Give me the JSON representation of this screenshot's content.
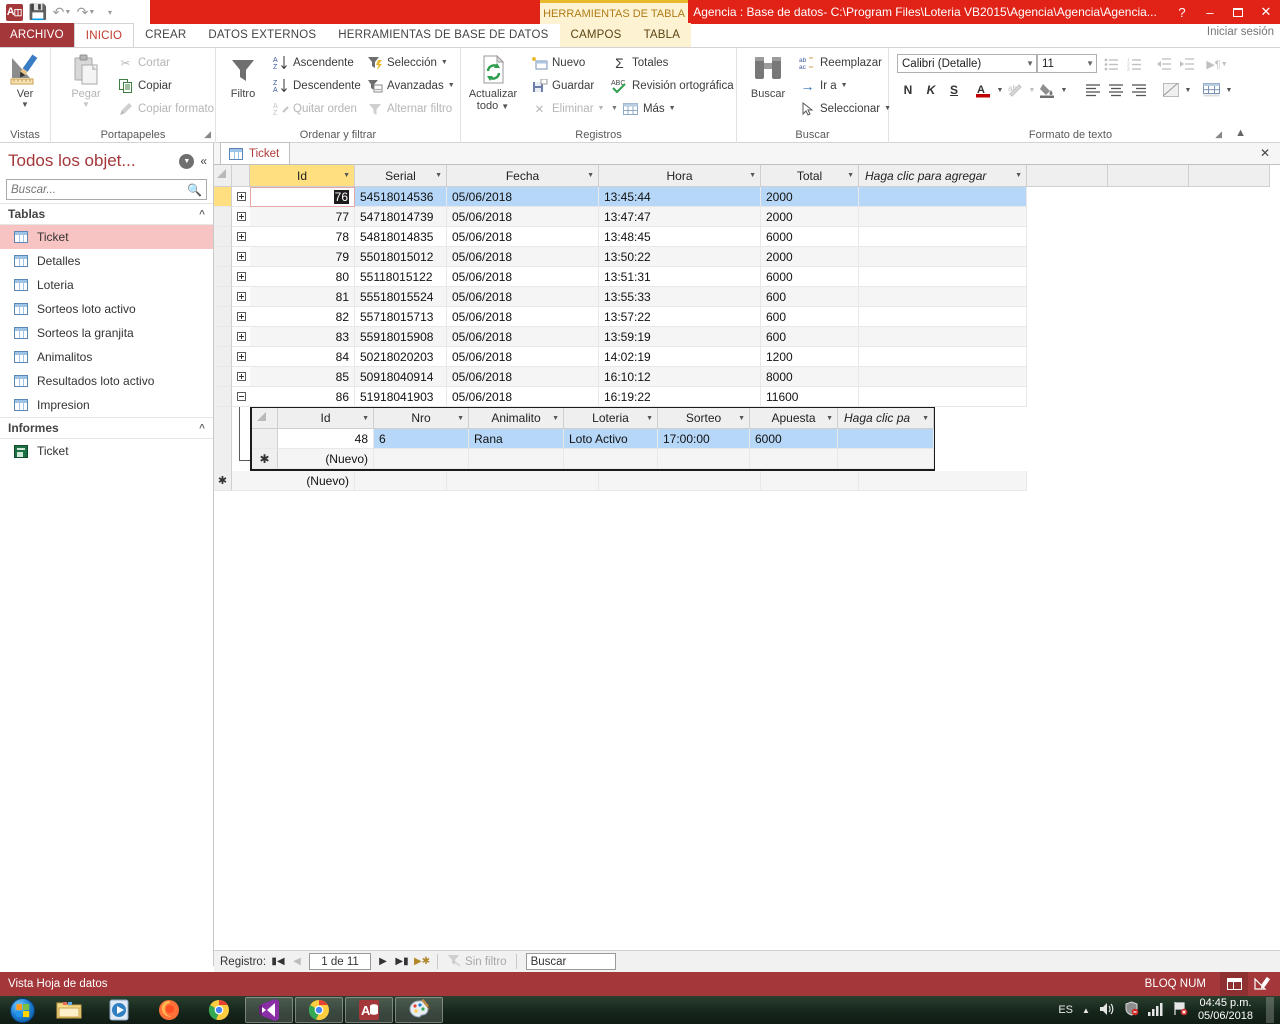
{
  "titlebar": {
    "app_icon": "access-logo-icon",
    "quick_access": [
      {
        "name": "save-icon",
        "glyph": "💾"
      },
      {
        "name": "undo-icon",
        "glyph": "↶"
      },
      {
        "name": "redo-icon",
        "glyph": "↷"
      },
      {
        "name": "customize-qat-icon",
        "glyph": "☰"
      }
    ],
    "contextual_tools_label": "HERRAMIENTAS DE TABLA",
    "document_title": "Agencia : Base de datos- C:\\Program Files\\Loteria VB2015\\Agencia\\Agencia\\Agencia...",
    "help": "?",
    "minimize": "–",
    "restore": "❐",
    "close": "✕",
    "accent_red": "#e02217",
    "accent_dark_red": "#a4373a",
    "contextual_yellow": "#e8b92b"
  },
  "ribbon_tabs": {
    "file": "ARCHIVO",
    "tabs": [
      "INICIO",
      "CREAR",
      "DATOS EXTERNOS",
      "HERRAMIENTAS DE BASE DE DATOS"
    ],
    "contextual_tabs": [
      "CAMPOS",
      "TABLA"
    ],
    "active": "INICIO",
    "sign_in": "Iniciar sesión"
  },
  "ribbon": {
    "groups": [
      {
        "name": "vistas",
        "title": "Vistas"
      },
      {
        "name": "portapapeles",
        "title": "Portapapeles"
      },
      {
        "name": "ordenar-y-filtrar",
        "title": "Ordenar y filtrar"
      },
      {
        "name": "registros",
        "title": "Registros"
      },
      {
        "name": "buscar",
        "title": "Buscar"
      },
      {
        "name": "formato-de-texto",
        "title": "Formato de texto"
      }
    ],
    "vistas": {
      "ver": "Ver"
    },
    "portapapeles": {
      "pegar": "Pegar",
      "cortar": "Cortar",
      "copiar": "Copiar",
      "copiar_formato": "Copiar formato"
    },
    "ordenar": {
      "filtro": "Filtro",
      "ascendente": "Ascendente",
      "descendente": "Descendente",
      "quitar_orden": "Quitar orden",
      "seleccion": "Selección",
      "avanzadas": "Avanzadas",
      "alternar_filtro": "Alternar filtro"
    },
    "registros": {
      "actualizar_todo": "Actualizar todo",
      "nuevo": "Nuevo",
      "guardar": "Guardar",
      "eliminar": "Eliminar",
      "totales": "Totales",
      "revision": "Revisión ortográfica",
      "mas": "Más"
    },
    "buscar": {
      "buscar": "Buscar",
      "reemplazar": "Reemplazar",
      "ir_a": "Ir a",
      "seleccionar": "Seleccionar"
    },
    "formato": {
      "font_name": "Calibri (Detalle)",
      "font_size": "11",
      "bold": "N",
      "italic": "K",
      "underline": "S"
    }
  },
  "navpane": {
    "title": "Todos los objet...",
    "search_placeholder": "Buscar...",
    "groups": [
      {
        "name": "tablas",
        "label": "Tablas",
        "items": [
          {
            "label": "Ticket",
            "selected": true
          },
          {
            "label": "Detalles",
            "selected": false
          },
          {
            "label": "Loteria",
            "selected": false
          },
          {
            "label": "Sorteos loto activo",
            "selected": false
          },
          {
            "label": "Sorteos la granjita",
            "selected": false
          },
          {
            "label": "Animalitos",
            "selected": false
          },
          {
            "label": "Resultados loto activo",
            "selected": false
          },
          {
            "label": "Impresion",
            "selected": false
          }
        ]
      },
      {
        "name": "informes",
        "label": "Informes",
        "items": [
          {
            "label": "Ticket",
            "selected": false
          }
        ]
      }
    ]
  },
  "document": {
    "tab_label": "Ticket",
    "close_label": "✕"
  },
  "datasheet": {
    "columns": [
      "Id",
      "Serial",
      "Fecha",
      "Hora",
      "Total"
    ],
    "add_column_label": "Haga clic para agregar",
    "key_column": "Id",
    "rows": [
      {
        "Id": "76",
        "Serial": "54518014536",
        "Fecha": "05/06/2018",
        "Hora": "13:45:44",
        "Total": "2000",
        "expanded": false,
        "current": true
      },
      {
        "Id": "77",
        "Serial": "54718014739",
        "Fecha": "05/06/2018",
        "Hora": "13:47:47",
        "Total": "2000",
        "expanded": false,
        "current": false
      },
      {
        "Id": "78",
        "Serial": "54818014835",
        "Fecha": "05/06/2018",
        "Hora": "13:48:45",
        "Total": "6000",
        "expanded": false,
        "current": false
      },
      {
        "Id": "79",
        "Serial": "55018015012",
        "Fecha": "05/06/2018",
        "Hora": "13:50:22",
        "Total": "2000",
        "expanded": false,
        "current": false
      },
      {
        "Id": "80",
        "Serial": "55118015122",
        "Fecha": "05/06/2018",
        "Hora": "13:51:31",
        "Total": "6000",
        "expanded": false,
        "current": false
      },
      {
        "Id": "81",
        "Serial": "55518015524",
        "Fecha": "05/06/2018",
        "Hora": "13:55:33",
        "Total": "600",
        "expanded": false,
        "current": false
      },
      {
        "Id": "82",
        "Serial": "55718015713",
        "Fecha": "05/06/2018",
        "Hora": "13:57:22",
        "Total": "600",
        "expanded": false,
        "current": false
      },
      {
        "Id": "83",
        "Serial": "55918015908",
        "Fecha": "05/06/2018",
        "Hora": "13:59:19",
        "Total": "600",
        "expanded": false,
        "current": false
      },
      {
        "Id": "84",
        "Serial": "50218020203",
        "Fecha": "05/06/2018",
        "Hora": "14:02:19",
        "Total": "1200",
        "expanded": false,
        "current": false
      },
      {
        "Id": "85",
        "Serial": "50918040914",
        "Fecha": "05/06/2018",
        "Hora": "16:10:12",
        "Total": "8000",
        "expanded": false,
        "current": false
      },
      {
        "Id": "86",
        "Serial": "51918041903",
        "Fecha": "05/06/2018",
        "Hora": "16:19:22",
        "Total": "11600",
        "expanded": true,
        "current": false
      }
    ],
    "new_row_label": "(Nuevo)",
    "selected_cell": {
      "row": 0,
      "column": "Id",
      "value": "76"
    }
  },
  "subdatasheet": {
    "columns": [
      "Id",
      "Nro",
      "Animalito",
      "Loteria",
      "Sorteo",
      "Apuesta"
    ],
    "add_column_label": "Haga clic pa",
    "rows": [
      {
        "Id": "48",
        "Nro": "6",
        "Animalito": "Rana",
        "Loteria": "Loto Activo",
        "Sorteo": "17:00:00",
        "Apuesta": "6000",
        "selected": true
      }
    ],
    "new_row_label": "(Nuevo)",
    "new_row_marker": "✱"
  },
  "record_nav": {
    "label": "Registro:",
    "first": "⏮",
    "prev": "◀",
    "position": "1 de 11",
    "next": "▶",
    "last": "⏭",
    "new": "▶✱",
    "filter_status": "Sin filtro",
    "search_placeholder": "Buscar"
  },
  "statusbar": {
    "view_name": "Vista Hoja de datos",
    "num_lock": "BLOQ NUM",
    "views": [
      {
        "name": "datasheet-view-button",
        "active": true
      },
      {
        "name": "design-view-button",
        "active": false
      }
    ]
  },
  "taskbar": {
    "start": "start-orb-icon",
    "items": [
      {
        "name": "file-explorer-icon",
        "open": false
      },
      {
        "name": "media-player-icon",
        "open": false
      },
      {
        "name": "firefox-icon",
        "open": false
      },
      {
        "name": "chrome-icon",
        "open": false
      },
      {
        "name": "visual-studio-icon",
        "open": true
      },
      {
        "name": "chrome-window-icon",
        "open": true
      },
      {
        "name": "access-window-icon",
        "open": true
      },
      {
        "name": "paint-icon",
        "open": true
      }
    ],
    "tray": {
      "language": "ES",
      "show_hidden": "▲",
      "volume": "volume-icon",
      "security": "security-shield-icon",
      "network_signal": "network-bars-icon",
      "action_flag": "action-center-icon",
      "time": "04:45 p.m.",
      "date": "05/06/2018"
    }
  }
}
